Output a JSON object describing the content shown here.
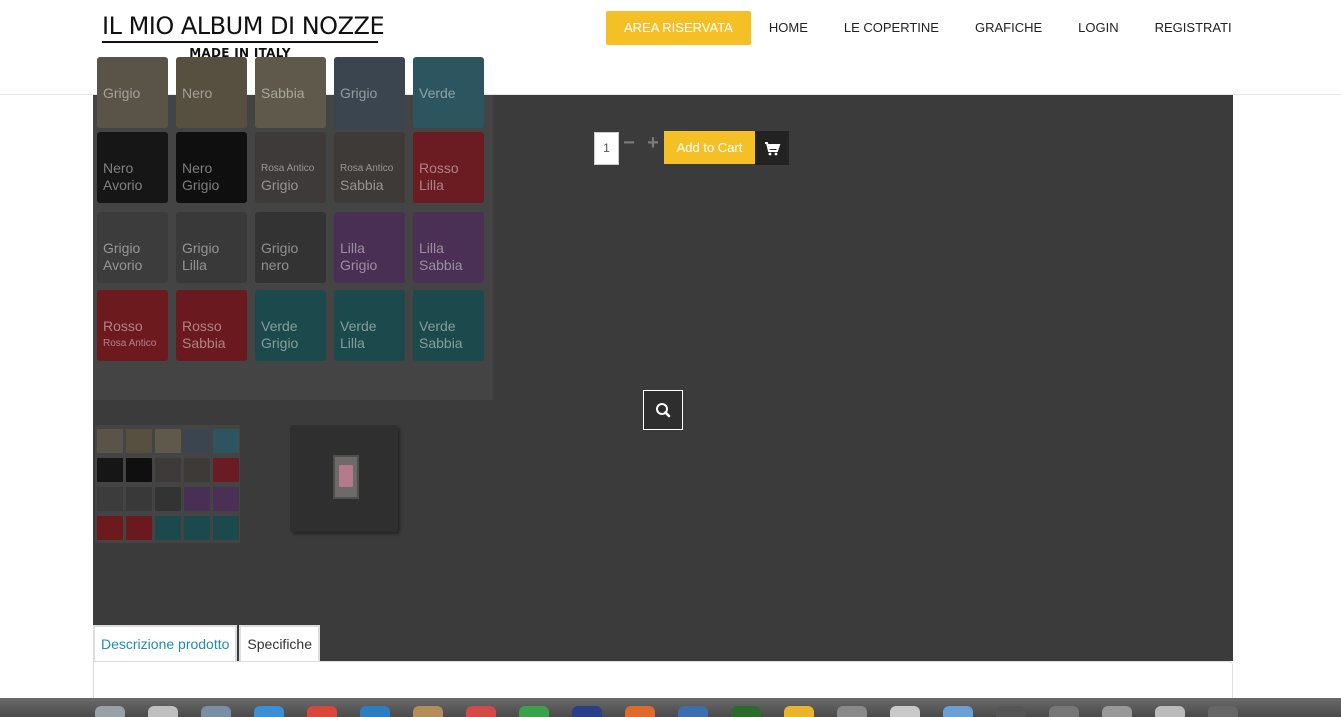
{
  "logo": {
    "title": "IL MIO ALBUM DI NOZZE",
    "subtitle": "MADE IN ITALY"
  },
  "nav": {
    "items": [
      {
        "label": "AREA RISERVATA"
      },
      {
        "label": "HOME"
      },
      {
        "label": "LE COPERTINE"
      },
      {
        "label": "GRAFICHE"
      },
      {
        "label": "LOGIN"
      },
      {
        "label": "REGISTRATI"
      }
    ]
  },
  "swatches": [
    {
      "lines": [
        "Grigio"
      ],
      "color": "#5a5347"
    },
    {
      "lines": [
        "Nero"
      ],
      "color": "#575040"
    },
    {
      "lines": [
        "Sabbia"
      ],
      "color": "#5f594c"
    },
    {
      "lines": [
        "Grigio"
      ],
      "color": "#3a4550"
    },
    {
      "lines": [
        "Verde"
      ],
      "color": "#2d5560"
    },
    {
      "lines": [
        "Nero",
        "Avorio"
      ],
      "color": "#161616"
    },
    {
      "lines": [
        "Nero",
        "Grigio"
      ],
      "color": "#0f0f0f"
    },
    {
      "lines": [
        "Rosa Antico",
        "Grigio"
      ],
      "color": "#3e3a3a"
    },
    {
      "lines": [
        "Rosa Antico",
        "Sabbia"
      ],
      "color": "#3e3a38"
    },
    {
      "lines": [
        "Rosso",
        "Lilla"
      ],
      "color": "#6b1b22"
    },
    {
      "lines": [
        "Grigio",
        "Avorio"
      ],
      "color": "#3c3c3c"
    },
    {
      "lines": [
        "Grigio",
        "Lilla"
      ],
      "color": "#393939"
    },
    {
      "lines": [
        "Grigio",
        "nero"
      ],
      "color": "#333333"
    },
    {
      "lines": [
        "Lilla",
        "Grigio"
      ],
      "color": "#4a2f55"
    },
    {
      "lines": [
        "Lilla",
        "Sabbia"
      ],
      "color": "#4a3055"
    },
    {
      "lines": [
        "Rosso",
        "Rosa Antico"
      ],
      "color": "#6d1a1f"
    },
    {
      "lines": [
        "Rosso",
        "Sabbia"
      ],
      "color": "#6a1a1e"
    },
    {
      "lines": [
        "Verde",
        "Grigio"
      ],
      "color": "#1c4a4c"
    },
    {
      "lines": [
        "Verde",
        "Lilla"
      ],
      "color": "#1c4a4c"
    },
    {
      "lines": [
        "Verde",
        "Sabbia"
      ],
      "color": "#1c4a4c"
    }
  ],
  "cart": {
    "quantity": "1",
    "minus": "−",
    "plus": "+",
    "add_label": "Add to Cart"
  },
  "tabs": [
    {
      "label": "Descrizione prodotto"
    },
    {
      "label": "Specifiche"
    }
  ],
  "colors": {
    "accent": "#f5c026",
    "tab_active": "#1f8ea8",
    "overlay": "#3b3b3b"
  }
}
